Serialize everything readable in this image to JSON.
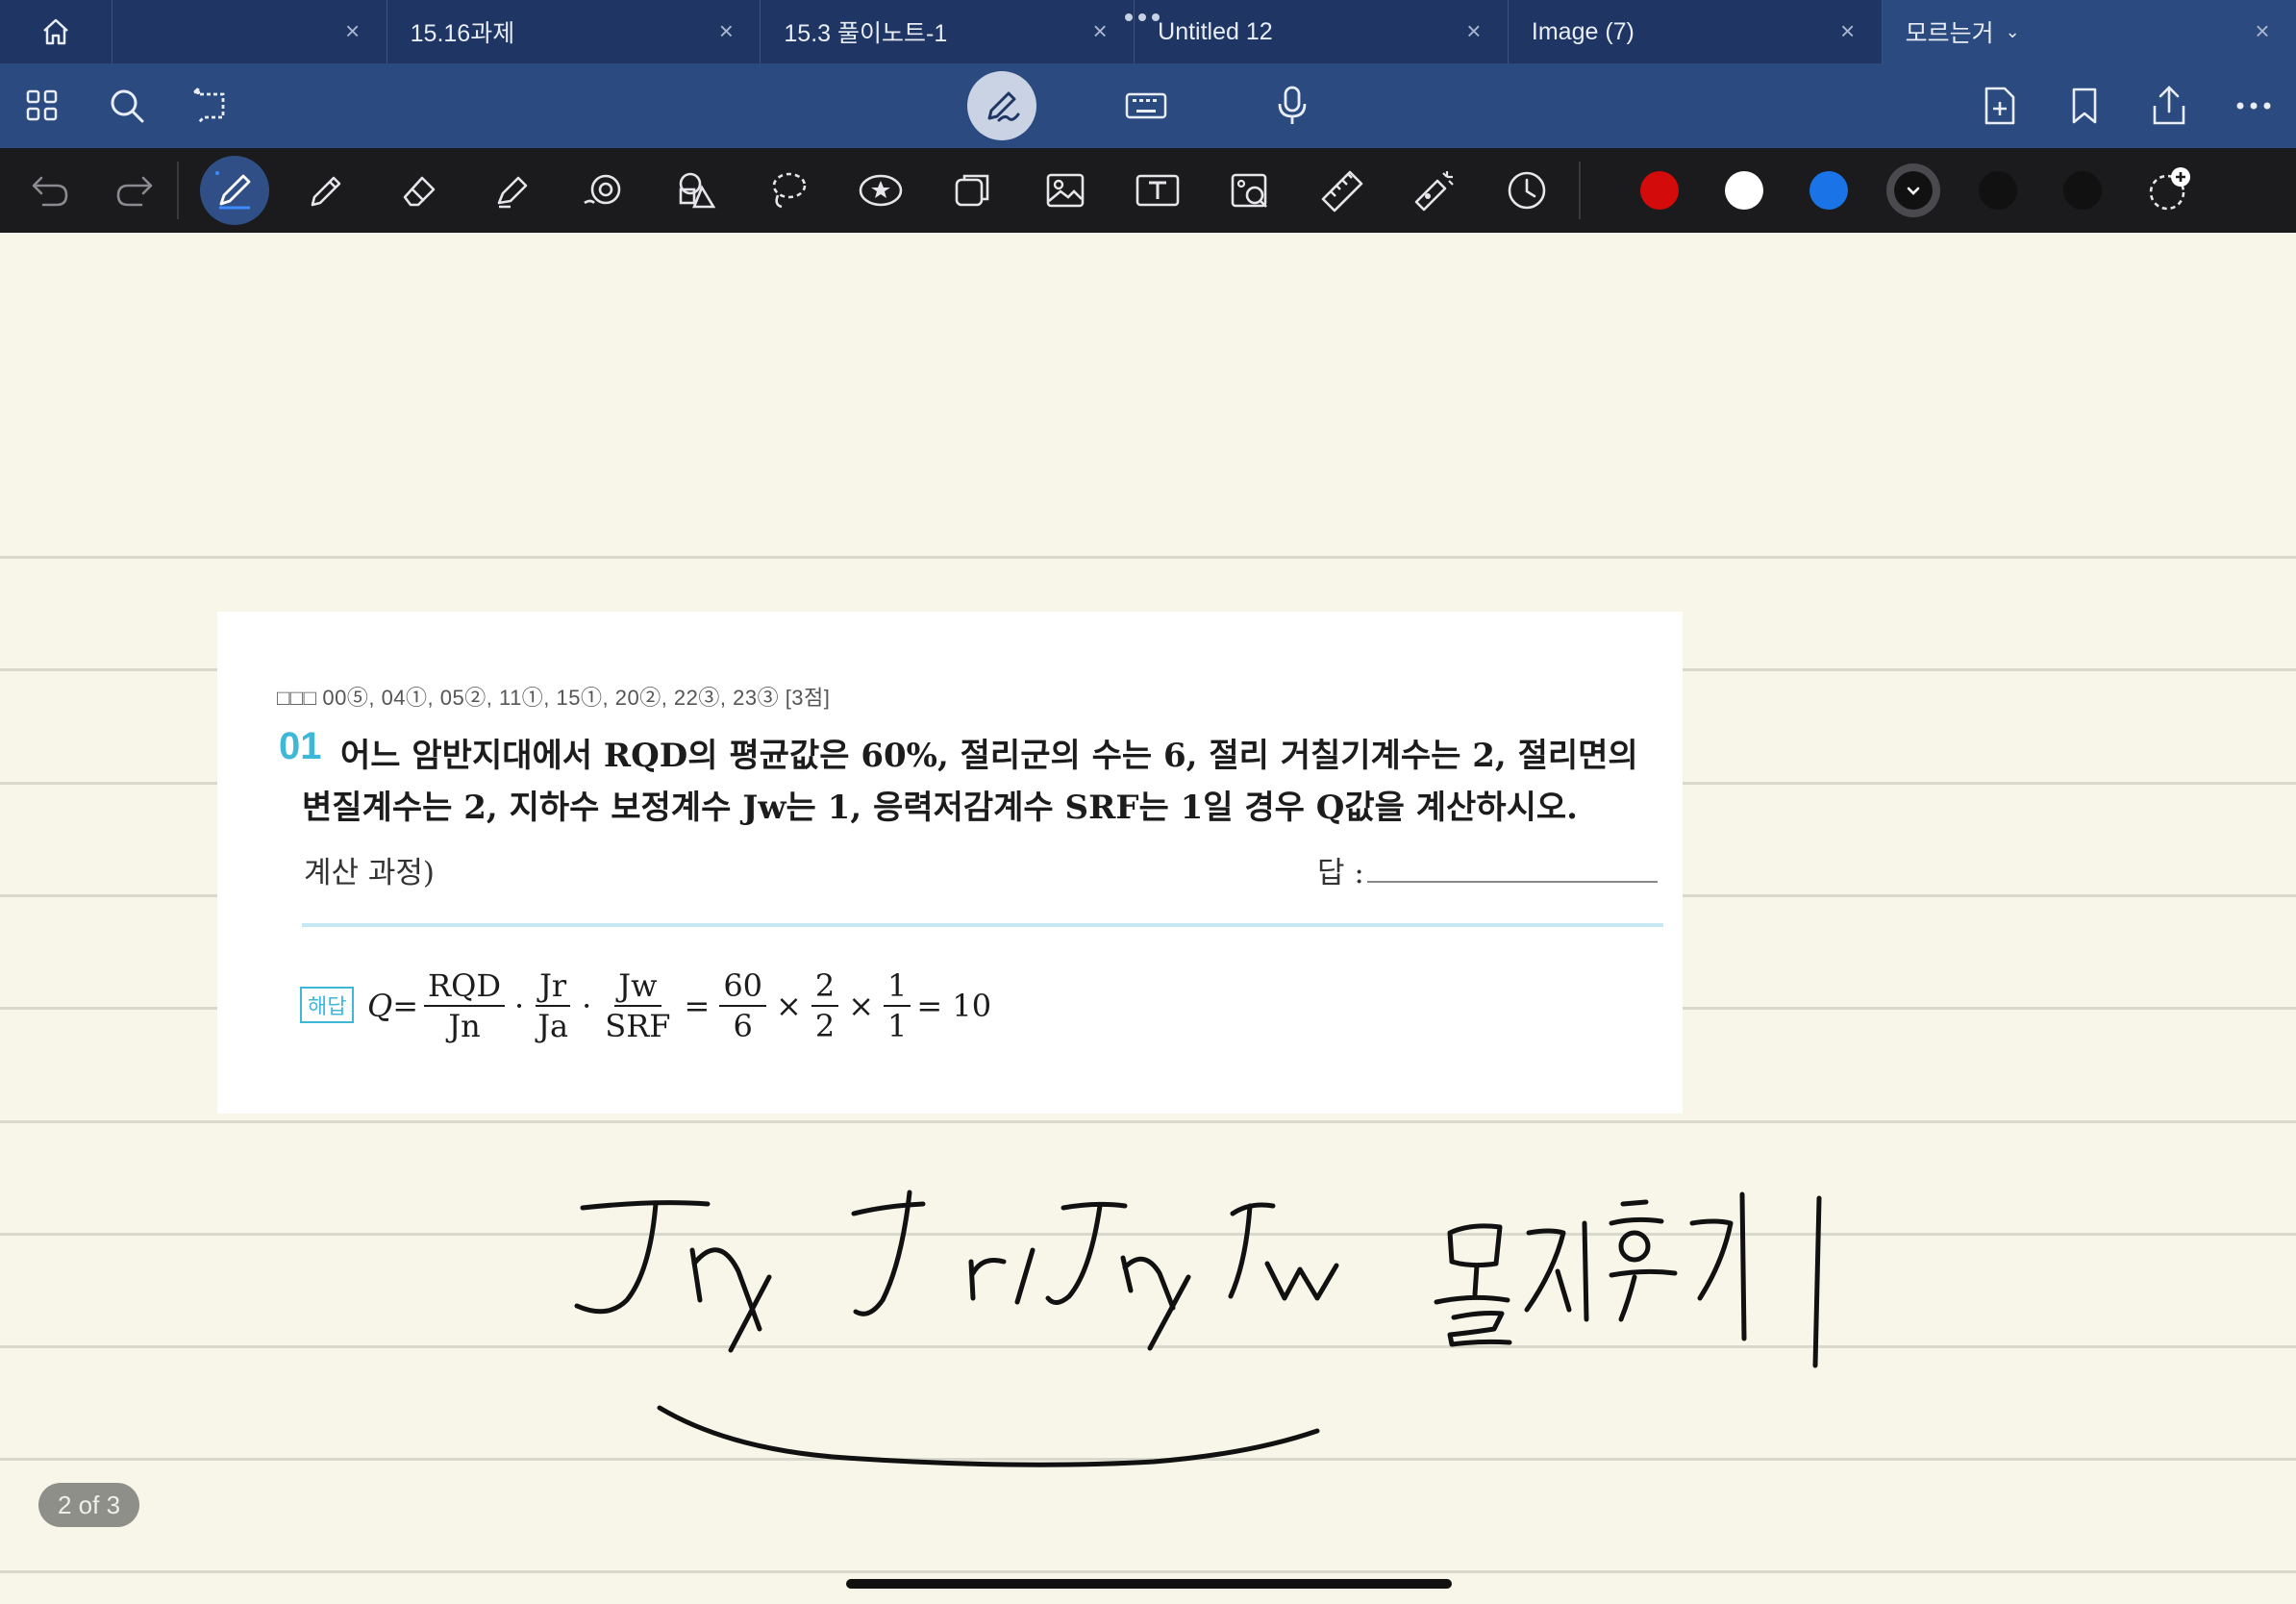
{
  "tabs": [
    {
      "label": ""
    },
    {
      "label": "15.16과제"
    },
    {
      "label": "15.3 풀이노트-1"
    },
    {
      "label": "Untitled 12"
    },
    {
      "label": "Image (7)"
    },
    {
      "label": "모르는거",
      "active": true
    }
  ],
  "toolbar": {
    "left_icons": [
      "grid-icon",
      "search-icon",
      "lasso-select-icon"
    ],
    "center_icons": [
      "pen-mode-icon",
      "keyboard-icon",
      "microphone-icon"
    ],
    "right_icons": [
      "add-page-icon",
      "bookmark-icon",
      "share-icon",
      "more-icon"
    ]
  },
  "tools": [
    "undo-icon",
    "redo-icon",
    "pen-tool-icon",
    "pencil-tool-icon",
    "eraser-tool-icon",
    "highlighter-tool-icon",
    "shape-tool-icon",
    "shapes-icon",
    "lasso-tool-icon",
    "sticker-icon",
    "elements-icon",
    "image-icon",
    "text-tool-icon",
    "camera-tool-icon",
    "ruler-icon",
    "laser-pointer-icon",
    "recent-icon"
  ],
  "colors": [
    "#d40b0b",
    "#ffffff",
    "#1a74e8",
    "#111111",
    "#111111",
    "#111111"
  ],
  "clip": {
    "meta": "00⑤, 04①, 05②, 11①, 15①, 20②, 22③, 23③ [3점]",
    "boxes": "□□□",
    "qnum": "01",
    "line1": "어느 암반지대에서 RQD의 평균값은 60%, 절리군의 수는 6, 절리 거칠기계수는 2, 절리면의",
    "line2": "변질계수는 2, 지하수 보정계수 Jw는 1, 응력저감계수 SRF는 1일 경우 Q값을 계산하시오.",
    "work_label": "계산 과정)",
    "answer_label": "답 :",
    "solution_badge": "해답",
    "formula": {
      "lhs": "Q=",
      "f1": {
        "num": "RQD",
        "den": "Jn"
      },
      "f2": {
        "num": "Jr",
        "den": "Ja"
      },
      "f3": {
        "num": "Jw",
        "den": "SRF"
      },
      "f4": {
        "num": "60",
        "den": "6"
      },
      "f5": {
        "num": "2",
        "den": "2"
      },
      "f6": {
        "num": "1",
        "den": "1"
      },
      "result": "= 10"
    }
  },
  "page_indicator": "2 of 3"
}
